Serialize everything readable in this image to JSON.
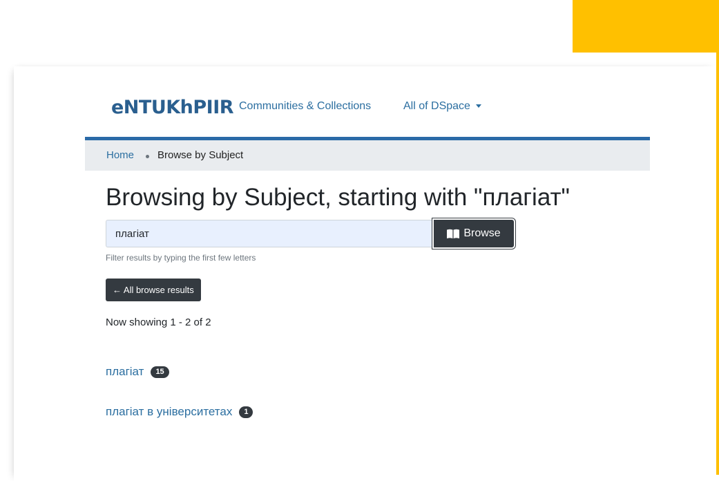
{
  "brand": {
    "logo_text": "eNTUKhPIIR"
  },
  "nav": {
    "communities_label": "Communities & Collections",
    "all_label": "All of DSpace"
  },
  "breadcrumb": {
    "home": "Home",
    "current": "Browse by Subject"
  },
  "page": {
    "title": "Browsing by Subject, starting with \"плагіат\""
  },
  "search": {
    "value": "плагіат",
    "button_label": "Browse",
    "help_text": "Filter results by typing the first few letters"
  },
  "back_button_label": "← All browse results",
  "showing_text": "Now showing 1 - 2 of 2",
  "results": [
    {
      "label": "плагіат",
      "count": "15"
    },
    {
      "label": "плагіат в університетах",
      "count": "1"
    }
  ],
  "colors": {
    "accent": "#ffc000",
    "link": "#2b6ea0",
    "dark": "#343a40",
    "nav_border": "#2a6aa7"
  }
}
